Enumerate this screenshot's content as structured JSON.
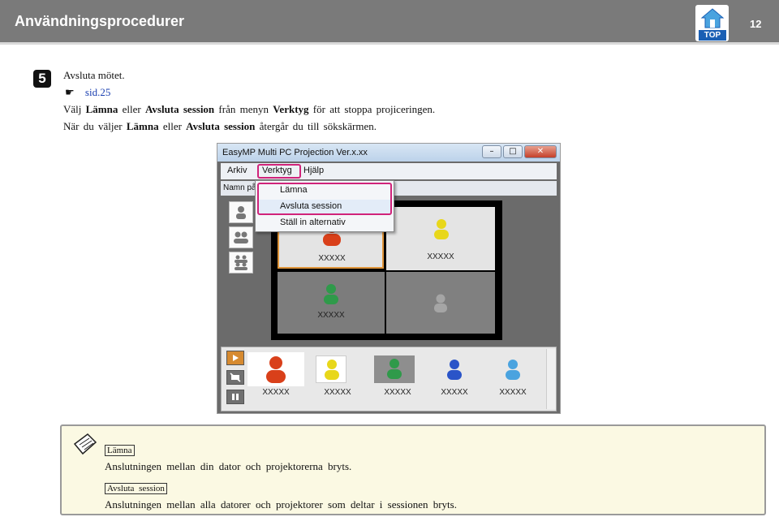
{
  "header": {
    "title": "Användningsprocedurer",
    "page_number": "12",
    "top_label": "TOP",
    "bg_color": "#7a7a7a"
  },
  "step": {
    "number": "5",
    "instruction": "Avsluta mötet.",
    "ref_symbol": "☛",
    "ref_link": "sid.25",
    "line1": {
      "a": "Välj",
      "b": "Lämna",
      "c": "eller",
      "d": "Avsluta session",
      "e": "från menyn",
      "f": "Verktyg",
      "g": "för att stoppa projiceringen."
    },
    "line2": {
      "a": "När du väljer",
      "b": "Lämna",
      "c": "eller",
      "d": "Avsluta session",
      "e": "återgår du till sökskärmen."
    }
  },
  "app": {
    "window_title": "EasyMP Multi PC Projection Ver.x.xx",
    "menu": [
      "Arkiv",
      "Verktyg",
      "Hjälp"
    ],
    "subbar_text": "Namn på",
    "dropdown": [
      "Lämna",
      "Avsluta session",
      "Ställ in alternativ"
    ],
    "grid_labels": [
      "XXXXX",
      "XXXXX",
      "XXXXX"
    ],
    "bottom_labels": [
      "XXXXX",
      "XXXXX",
      "XXXXX",
      "XXXXX",
      "XXXXX"
    ],
    "highlight_color": "#d0237a"
  },
  "note": {
    "tag1": "Lämna",
    "text1": "Anslutningen mellan din dator och projektorerna bryts.",
    "tag2": "Avsluta session",
    "text2": "Anslutningen mellan alla datorer och projektorer som deltar i sessionen bryts."
  }
}
